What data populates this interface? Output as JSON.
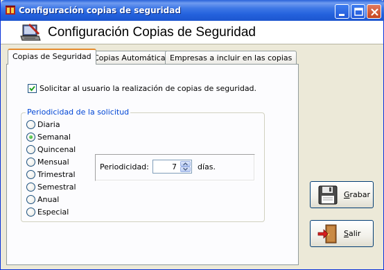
{
  "window": {
    "title": "Configuración copias de seguridad",
    "header_title": "Configuración Copias de Seguridad"
  },
  "tabs": [
    {
      "label": "Copias de Seguridad",
      "active": true
    },
    {
      "label": "Copias Automáticas",
      "active": false
    },
    {
      "label": "Empresas a incluir en las copias",
      "active": false
    }
  ],
  "checkbox": {
    "label": "Solicitar al usuario la realización de copias de seguridad.",
    "checked": true
  },
  "group": {
    "legend": "Periodicidad de la solicitud",
    "options": [
      {
        "label": "Diaria",
        "selected": false
      },
      {
        "label": "Semanal",
        "selected": true
      },
      {
        "label": "Quincenal",
        "selected": false
      },
      {
        "label": "Mensual",
        "selected": false
      },
      {
        "label": "Trimestral",
        "selected": false
      },
      {
        "label": "Semestral",
        "selected": false
      },
      {
        "label": "Anual",
        "selected": false
      },
      {
        "label": "Especial",
        "selected": false
      }
    ]
  },
  "periodicity": {
    "label": "Periodicidad:",
    "value": "7",
    "unit": "días."
  },
  "buttons": {
    "grabar": {
      "mnemonic": "G",
      "rest": "rabar"
    },
    "salir": {
      "mnemonic": "S",
      "rest": "alir"
    }
  },
  "colors": {
    "titlebar": "#2361dc",
    "legend": "#0046d5",
    "active_tab_accent": "#e68b2c",
    "radio_selected": "#21a121"
  }
}
